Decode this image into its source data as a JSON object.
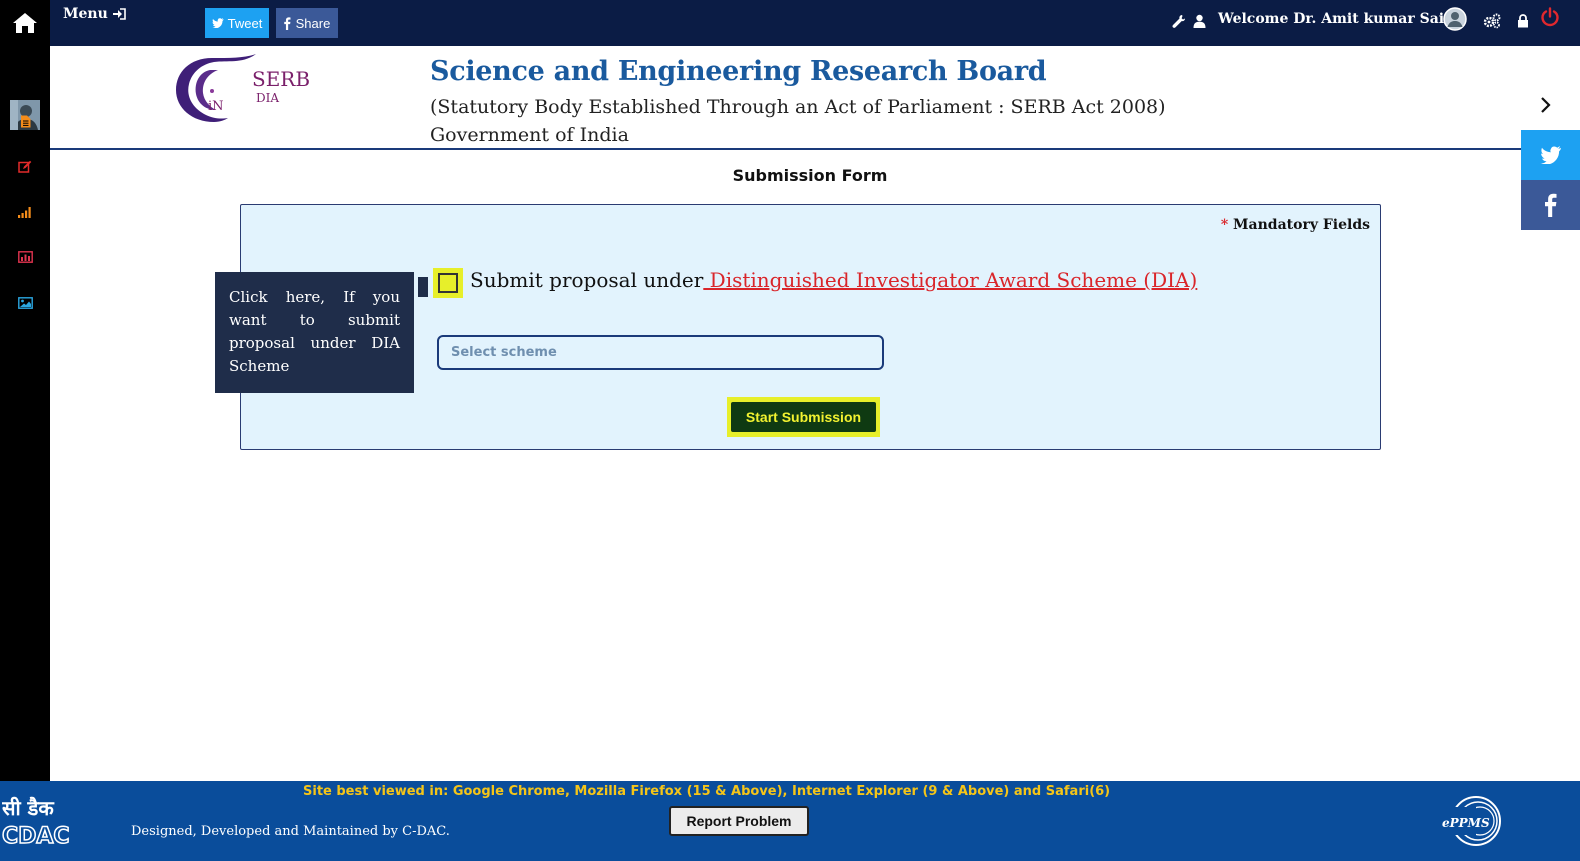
{
  "topbar": {
    "menu_label": "Menu",
    "tweet_label": "Tweet",
    "share_label": "Share",
    "welcome_text": "Welcome Dr. Amit kumar Saini",
    "bg_color": "#0b1c45"
  },
  "header": {
    "logo_text_main": "SERB",
    "logo_text_sub": "DIA",
    "logo_text_in": "iN",
    "title": "Science and Engineering Research Board",
    "subtitle": "(Statutory Body Established Through an Act of Parliament : SERB Act 2008)",
    "subtitle2": "Government of India"
  },
  "form": {
    "title": "Submission Form",
    "mandatory_star": "*",
    "mandatory_label": "Mandatory Fields",
    "checkbox_prefix": "Submit proposal under",
    "checkbox_link": " Distinguished Investigator Award Scheme (DIA)",
    "select_placeholder": "Select scheme",
    "start_button": "Start Submission",
    "tooltip": "Click here, If you want to submit proposal under DIA Scheme",
    "highlight_color": "#e7ef2a"
  },
  "footer": {
    "best_viewed": "Site best viewed in: Google Chrome, Mozilla Firefox (15 & Above), Internet Explorer (9 & Above) and Safari(6)",
    "designed": "Designed, Developed and Maintained by C-DAC.",
    "report_button": "Report Problem",
    "cdac_hindi": "सी डैक",
    "cdac_text": "CDAC",
    "eppms_text": "ePPMS",
    "bg_color": "#0a4d9b"
  },
  "icons": [
    "home-icon",
    "sign-in-icon",
    "twitter-icon",
    "facebook-icon",
    "wrench-icon",
    "user-icon",
    "profile-avatar",
    "cogs-icon",
    "lock-icon",
    "power-icon",
    "file-icon",
    "edit-icon",
    "signal-icon",
    "bar-chart-icon",
    "image-icon",
    "chevron-right-icon"
  ]
}
